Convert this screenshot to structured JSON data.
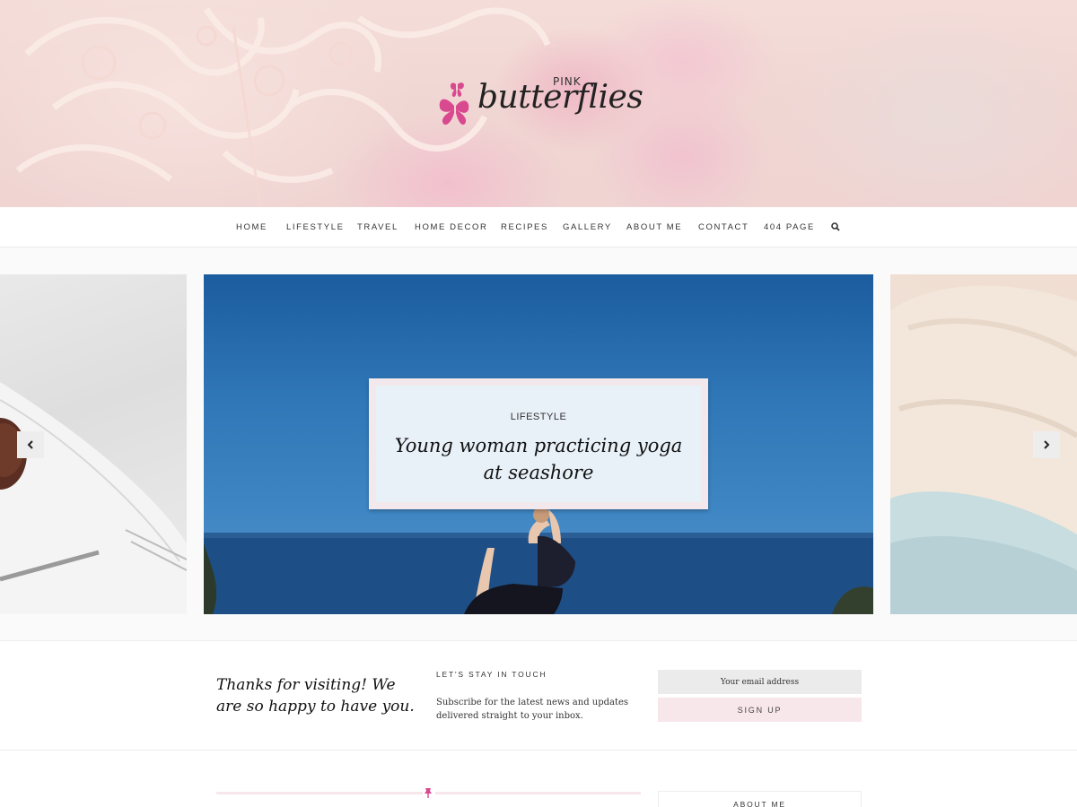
{
  "brand": {
    "small": "PINK",
    "name": "butterflies"
  },
  "nav": {
    "items": [
      "HOME",
      "LIFESTYLE",
      "TRAVEL",
      "HOME DECOR",
      "RECIPES",
      "GALLERY",
      "ABOUT ME",
      "CONTACT",
      "404 PAGE"
    ],
    "search_icon": "search-icon"
  },
  "slider": {
    "active": {
      "category": "LIFESTYLE",
      "title": "Young woman practicing yoga at seashore"
    },
    "prev_icon": "chevron-left-icon",
    "next_icon": "chevron-right-icon"
  },
  "subscribe": {
    "tagline": "Thanks for visiting! We are so happy to have you.",
    "heading": "LET'S STAY IN TOUCH",
    "text": "Subscribe for the latest news and updates delivered straight to your inbox.",
    "email_placeholder": "Your email address",
    "button": "SIGN UP"
  },
  "sidebar": {
    "about_title": "ABOUT ME"
  },
  "colors": {
    "accent_pink": "#d9498f",
    "soft_pink": "#f7e6ea"
  }
}
